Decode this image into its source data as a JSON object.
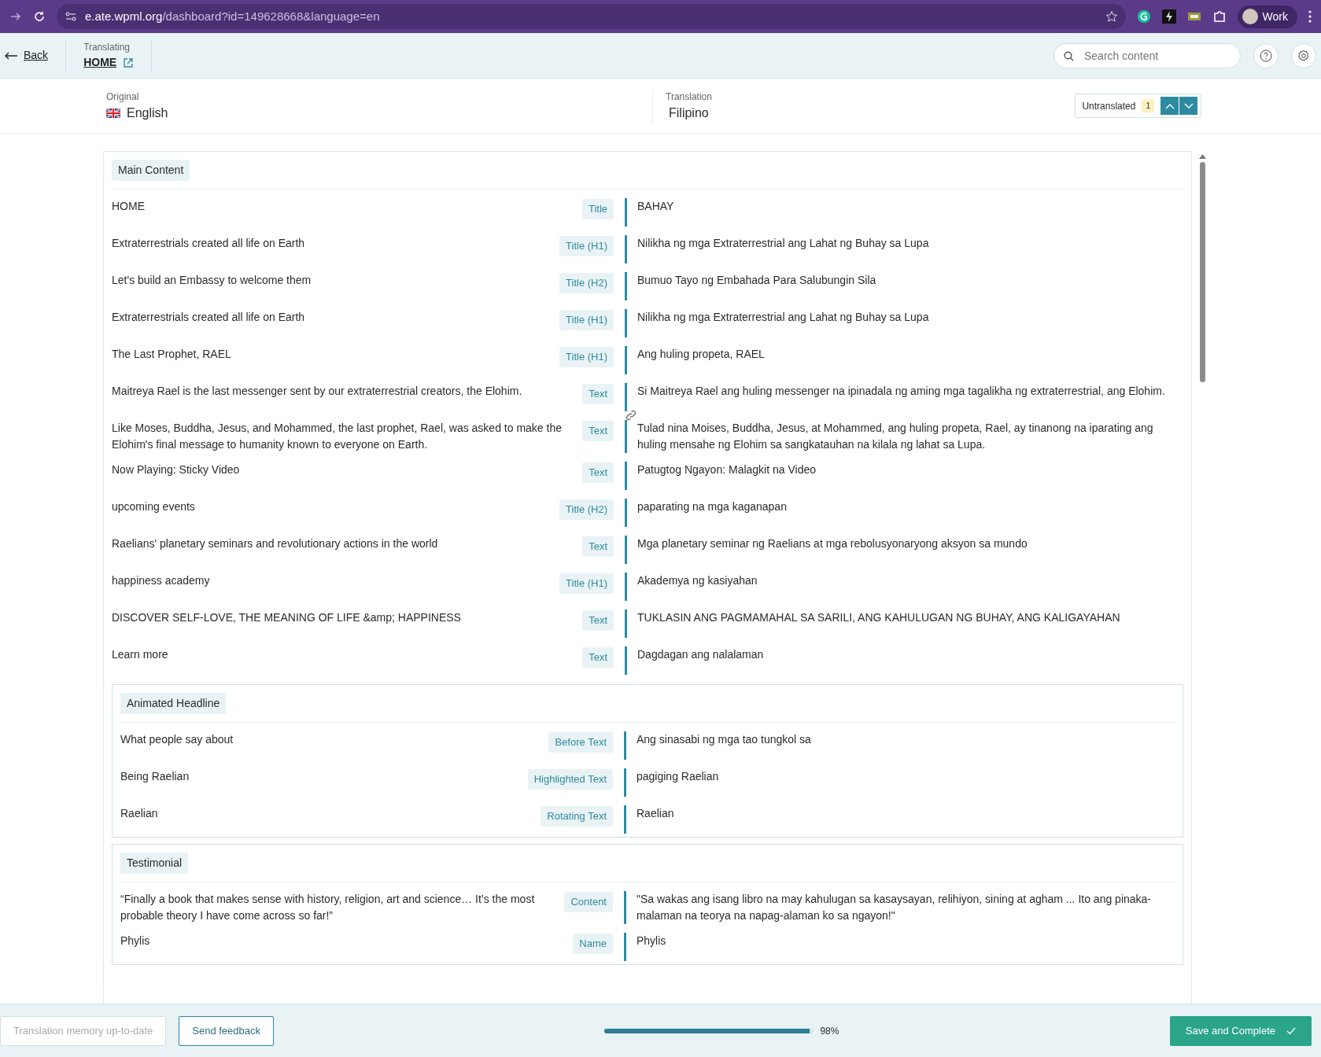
{
  "browser": {
    "url_host": "e.ate.wpml.org",
    "url_path": "/dashboard?id=149628668&language=en",
    "profile": "Work"
  },
  "header": {
    "back": "Back",
    "translating_label": "Translating",
    "page_title": "HOME",
    "search": {
      "placeholder": "Search content"
    }
  },
  "languages": {
    "original_label": "Original",
    "original": "English",
    "translation_label": "Translation",
    "translation": "Filipino",
    "filter": "Untranslated",
    "filter_count": "1"
  },
  "sections": [
    {
      "title": "Main Content",
      "boxed": false,
      "rows": [
        {
          "source": "HOME",
          "type": "Title",
          "target": "BAHAY"
        },
        {
          "source": "Extraterrestrials created all life on Earth",
          "type": "Title (H1)",
          "target": "Nilikha ng mga Extraterrestrial ang Lahat ng Buhay sa Lupa"
        },
        {
          "source": "Let's build an Embassy to welcome them",
          "type": "Title (H2)",
          "target": "Bumuo Tayo ng Embahada Para Salubungin Sila"
        },
        {
          "source": "Extraterrestrials created all life on Earth",
          "type": "Title (H1)",
          "target": "Nilikha ng mga Extraterrestrial ang Lahat ng Buhay sa Lupa"
        },
        {
          "source": "The Last Prophet, RAEL",
          "type": "Title (H1)",
          "target": "Ang huling propeta, RAEL"
        },
        {
          "source": "Maitreya Rael is the last messenger sent by our extraterrestrial creators, the Elohim.",
          "type": "Text",
          "target": "Si Maitreya Rael ang huling messenger na ipinadala ng aming mga tagalikha ng extraterrestrial, ang Elohim.",
          "linked": true
        },
        {
          "source": "Like Moses, Buddha, Jesus, and Mohammed, the last prophet, Rael, was asked to make the Elohim's final message to humanity known to everyone on Earth.",
          "type": "Text",
          "target": "Tulad nina Moises, Buddha, Jesus, at Mohammed, ang huling propeta, Rael, ay tinanong na iparating ang huling mensahe ng Elohim sa sangkatauhan na kilala ng lahat sa Lupa."
        },
        {
          "source": "Now Playing: Sticky Video",
          "type": "Text",
          "target": "Patugtog Ngayon: Malagkit na Video"
        },
        {
          "source": "upcoming events",
          "type": "Title (H2)",
          "target": "paparating na mga kaganapan"
        },
        {
          "source": "Raelians' planetary seminars and revolutionary actions in the world",
          "type": "Text",
          "target": "Mga planetary seminar ng Raelians at mga rebolusyonaryong aksyon sa mundo"
        },
        {
          "source": "happiness academy",
          "type": "Title (H1)",
          "target": "Akademya ng kasiyahan"
        },
        {
          "source": "DISCOVER SELF-LOVE, THE MEANING OF LIFE &amp; HAPPINESS",
          "type": "Text",
          "target": "TUKLASIN ANG PAGMAMAHAL SA SARILI, ANG KAHULUGAN NG BUHAY, ANG KALIGAYAHAN"
        },
        {
          "source": "Learn more",
          "type": "Text",
          "target": "Dagdagan ang nalalaman"
        }
      ]
    },
    {
      "title": "Animated Headline",
      "boxed": true,
      "rows": [
        {
          "source": "What people say about",
          "type": "Before Text",
          "target": "Ang sinasabi ng mga tao tungkol sa"
        },
        {
          "source": "Being Raelian",
          "type": "Highlighted Text",
          "target": "pagiging Raelian"
        },
        {
          "source": "Raelian",
          "type": "Rotating Text",
          "target": "Raelian"
        }
      ]
    },
    {
      "title": "Testimonial",
      "boxed": true,
      "rows": [
        {
          "source": "“Finally a book that makes sense with history, religion, art and science… It’s the most probable theory I have come across so far!”",
          "type": "Content",
          "target": "\"Sa wakas ang isang libro na may kahulugan sa kasaysayan, relihiyon, sining at agham ... Ito ang pinaka-malaman na teorya na napag-alaman ko sa ngayon!\""
        },
        {
          "source": "Phylis",
          "type": "Name",
          "target": "Phylis"
        }
      ]
    }
  ],
  "footer": {
    "memory": {
      "label": "Translation memory up-to-date",
      "disabled": true
    },
    "feedback": "Send feedback",
    "progress": {
      "level": 0.98,
      "reading": "98%"
    },
    "save": "Save and Complete"
  }
}
